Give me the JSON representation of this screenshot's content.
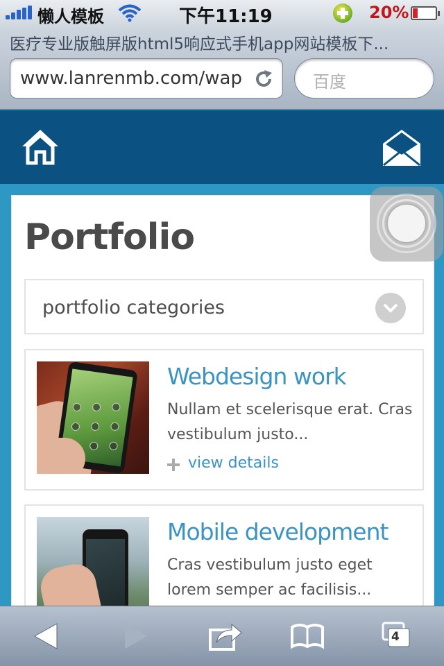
{
  "status_bar": {
    "carrier": "懒人模板",
    "time": "下午11:19",
    "battery_percent": "20%",
    "battery_level": 0.2
  },
  "browser": {
    "page_title": "医疗专业版触屏版html5响应式手机app网站模板下...",
    "url": "www.lanrenmb.com/wap",
    "search_placeholder": "百度"
  },
  "page": {
    "heading": "Portfolio",
    "categories_label": "portfolio categories",
    "items": [
      {
        "title": "Webdesign work",
        "description": "Nullam et scelerisque erat. Cras vestibulum justo...",
        "link_label": "view details"
      },
      {
        "title": "Mobile development",
        "description": "Cras vestibulum justo eget lorem semper ac facilisis..."
      }
    ]
  },
  "toolbar": {
    "tabs_count": "4"
  },
  "colors": {
    "header_bg": "#0b5182",
    "page_bg": "#2f97c4",
    "accent": "#3a93c3"
  },
  "icons": [
    "home-icon",
    "mail-icon",
    "reload-icon",
    "chevron-down-icon",
    "back-icon",
    "forward-icon",
    "share-icon",
    "bookmarks-icon",
    "tabs-icon"
  ]
}
